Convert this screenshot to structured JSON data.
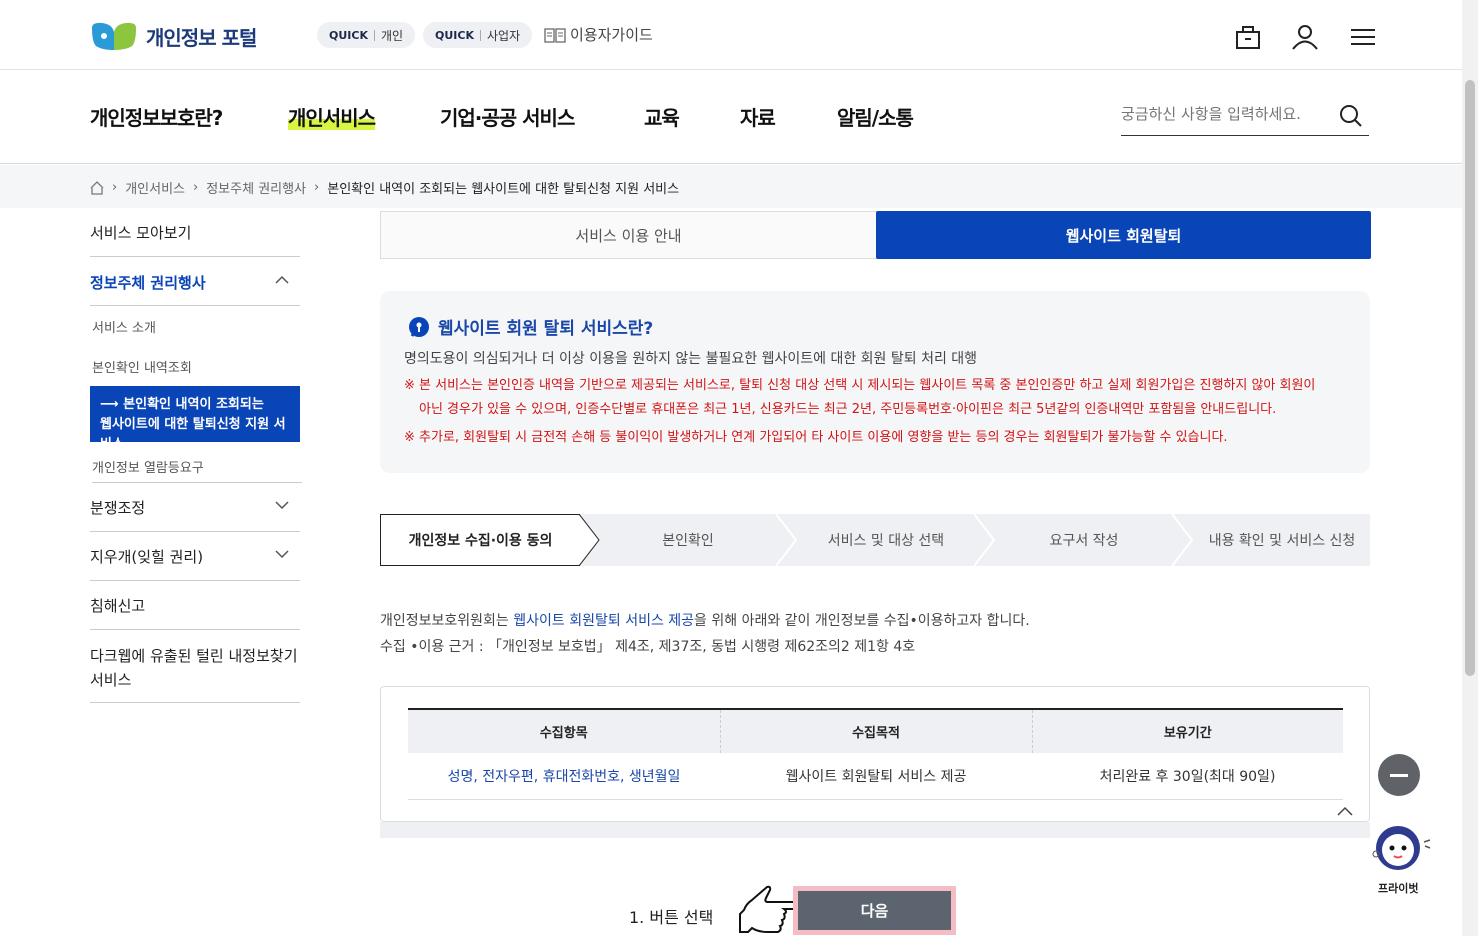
{
  "header": {
    "logo_text": "개인정보 포털",
    "quick": [
      {
        "tag": "QUICK",
        "label": "개인"
      },
      {
        "tag": "QUICK",
        "label": "사업자"
      }
    ],
    "guide_label": "이용자가이드"
  },
  "nav": {
    "items": [
      "개인정보보호란?",
      "개인서비스",
      "기업·공공 서비스",
      "교육",
      "자료",
      "알림/소통"
    ],
    "active_index": 1,
    "search_placeholder": "궁금하신 사항을 입력하세요."
  },
  "breadcrumb": [
    "개인서비스",
    "정보주체 권리행사",
    "본인확인 내역이 조회되는 웹사이트에 대한 탈퇴신청 지원 서비스"
  ],
  "sidebar": {
    "overview": "서비스 모아보기",
    "rights": "정보주체 권리행사",
    "sub": [
      "서비스 소개",
      "본인확인 내역조회"
    ],
    "active_line1": "본인확인 내역이 조회되는",
    "active_line2": "웹사이트에 대한 탈퇴신청 지원 서비스",
    "sub_last": "개인정보 열람등요구",
    "dispute": "분쟁조정",
    "erasure": "지우개(잊힐 권리)",
    "report": "침해신고",
    "darkweb_line1": "다크웹에 유출된 털린 내정보찾기",
    "darkweb_line2": "서비스"
  },
  "tabs": {
    "guide": "서비스 이용 안내",
    "withdraw": "웹사이트 회원탈퇴"
  },
  "info": {
    "title": "웹사이트 회원 탈퇴 서비스란?",
    "desc": "명의도용이 의심되거나 더 이상 이용을 원하지 않는 불필요한 웹사이트에 대한 회원 탈퇴 처리 대행",
    "note1_line1": "※ 본 서비스는 본인인증 내역을 기반으로 제공되는 서비스로, 탈퇴 신청 대상 선택 시 제시되는 웹사이트 목록 중 본인인증만 하고 실제 회원가입은 진행하지 않아 회원이",
    "note1_line2": "아닌 경우가 있을 수 있으며, 인증수단별로 휴대폰은 최근 1년, 신용카드는 최근 2년, 주민등록번호·아이핀은 최근 5년같의 인증내역만 포함됨을 안내드립니다.",
    "note2": "※ 추가로, 회원탈퇴 시 금전적 손해 등 불이익이 발생하거나 연계 가입되어 타 사이트 이용에 영향을 받는 등의 경우는 회원탈퇴가 불가능할 수 있습니다."
  },
  "steps": [
    "개인정보 수집·이용 동의",
    "본인확인",
    "서비스 및 대상 선택",
    "요구서 작성",
    "내용 확인 및 서비스 신청"
  ],
  "body": {
    "line1_pre": "개인정보보호위원회는 ",
    "line1_hl": "웹사이트 회원탈퇴 서비스 제공",
    "line1_post": "을 위해 아래와 같이 개인정보를 수집•이용하고자 합니다.",
    "line2": "수집 •이용 근거 : 「개인정보 보호법」 제4조, 제37조, 동법 시행령 제62조의2 제1항 4호"
  },
  "table": {
    "headers": [
      "수집항목",
      "수집목적",
      "보유기간"
    ],
    "row": [
      "성명, 전자우편, 휴대전화번호, 생년월일",
      "웹사이트 회원탈퇴 서비스 제공",
      "처리완료 후 30일(최대 90일)"
    ]
  },
  "bottom": {
    "annotation": "1. 버튼 선택",
    "next_label": "다음"
  },
  "floating": {
    "mascot_label": "프라이벗"
  },
  "colors": {
    "primary": "#0a45b8",
    "warning": "#d31414",
    "highlight": "#d9f542"
  }
}
